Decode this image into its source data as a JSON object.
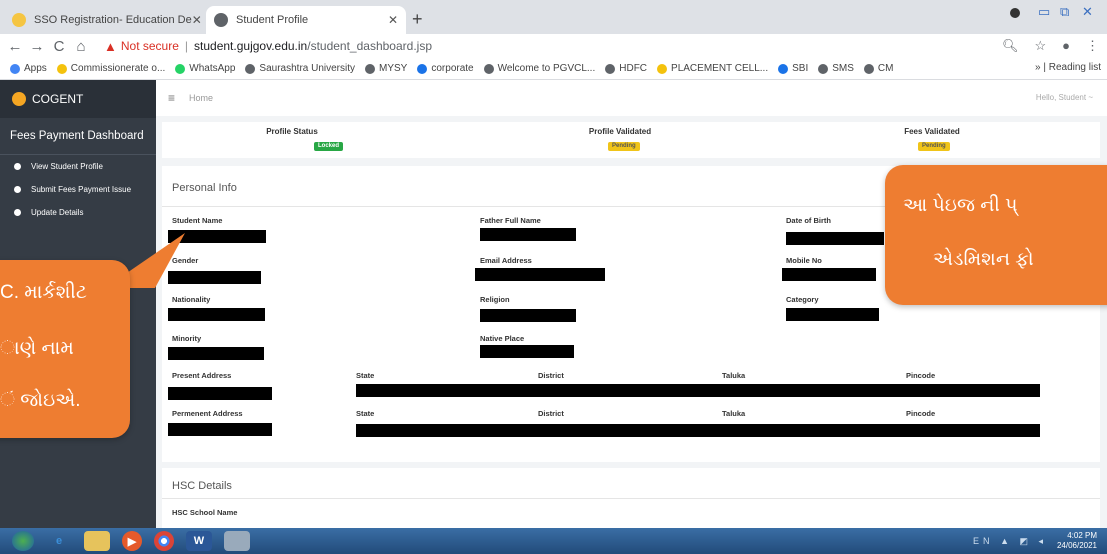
{
  "browser": {
    "tabs": [
      {
        "title": "SSO Registration- Education De",
        "active": false
      },
      {
        "title": "Student Profile",
        "active": true
      }
    ],
    "new_tab": "+",
    "window_controls": {
      "minimize": "▭",
      "maximize": "⧉",
      "close": "✕"
    },
    "back": "←",
    "forward": "→",
    "reload": "C",
    "home": "⌂",
    "not_secure_label": "Not secure",
    "url_host": "student.gujgov.edu.in",
    "url_path": "/student_dashboard.jsp",
    "bookmarks": [
      "Apps",
      "Commissionerate o...",
      "WhatsApp",
      "Saurashtra University",
      "MYSY",
      "corporate",
      "Welcome to PGVCL...",
      "HDFC",
      "PLACEMENT CELL...",
      "SBI",
      "SMS",
      "CM"
    ],
    "reading_list": "Reading list",
    "bookmark_overflow": "»"
  },
  "sidebar": {
    "brand": "COGENT",
    "dashboard_title": "Fees Payment Dashboard",
    "items": [
      {
        "label": "View Student Profile"
      },
      {
        "label": "Submit Fees Payment Issue"
      },
      {
        "label": "Update Details"
      }
    ]
  },
  "topbar": {
    "menu_icon": "≡",
    "breadcrumb": "Home",
    "greeting": "Hello, Student ~"
  },
  "status": {
    "profile_status_label": "Profile Status",
    "profile_status_badge": "Locked",
    "profile_validated_label": "Profile Validated",
    "profile_validated_badge": "Pending",
    "fees_validated_label": "Fees Validated",
    "fees_validated_badge": "Pending",
    "colors": {
      "locked": "#28a745",
      "pending": "#f0c419"
    }
  },
  "personal_info": {
    "title": "Personal Info",
    "labels": {
      "student_name": "Student Name",
      "father_full_name": "Father Full Name",
      "date_of_birth": "Date of Birth",
      "gender": "Gender",
      "email": "Email Address",
      "mobile": "Mobile No",
      "nationality": "Nationality",
      "religion": "Religion",
      "category": "Category",
      "minority": "Minority",
      "native_place": "Native Place",
      "present_address": "Present Address",
      "permanent_address": "Permenent Address",
      "state": "State",
      "district": "District",
      "taluka": "Taluka",
      "pincode": "Pincode"
    }
  },
  "hsc": {
    "title": "HSC Details",
    "school_name_label": "HSC School Name"
  },
  "callouts": {
    "right_line1": "આ પેઇજ ની પ્",
    "right_line2": "એડમિશન ફો",
    "left_line1": "C. માર્કશીટ",
    "left_line2": "ાણે નામ",
    "left_line3": "ં જોઇએ."
  },
  "taskbar": {
    "lang": "EN",
    "time": "4:02 PM",
    "date": "24/06/2021"
  }
}
